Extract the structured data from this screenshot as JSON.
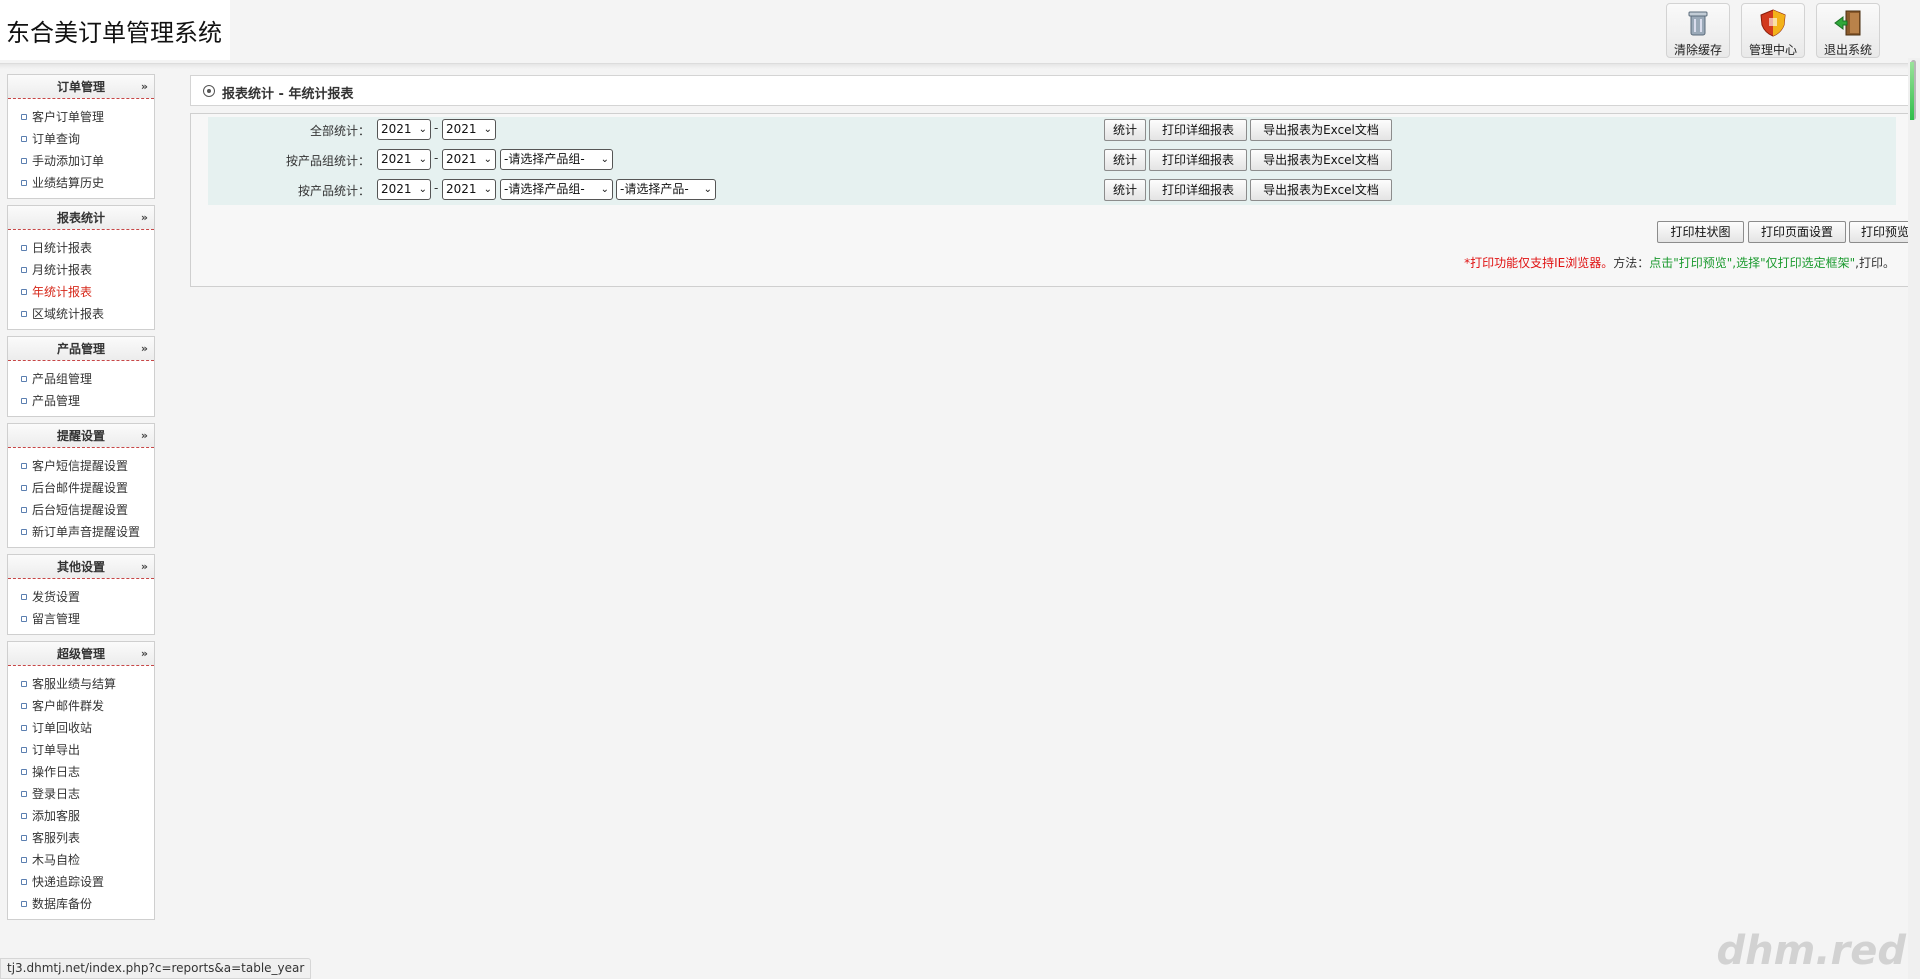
{
  "app": {
    "title": "东合美订单管理系统"
  },
  "toolbar": {
    "buttons": [
      {
        "label": "清除缓存",
        "icon": "trash-icon"
      },
      {
        "label": "管理中心",
        "icon": "shield-icon"
      },
      {
        "label": "退出系统",
        "icon": "exit-door-icon"
      }
    ]
  },
  "sidebar": {
    "groups": [
      {
        "title": "订单管理",
        "items": [
          "客户订单管理",
          "订单查询",
          "手动添加订单",
          "业绩结算历史"
        ]
      },
      {
        "title": "报表统计",
        "items": [
          "日统计报表",
          "月统计报表",
          "年统计报表",
          "区域统计报表"
        ],
        "active_index": 2
      },
      {
        "title": "产品管理",
        "items": [
          "产品组管理",
          "产品管理"
        ]
      },
      {
        "title": "提醒设置",
        "items": [
          "客户短信提醒设置",
          "后台邮件提醒设置",
          "后台短信提醒设置",
          "新订单声音提醒设置"
        ]
      },
      {
        "title": "其他设置",
        "items": [
          "发货设置",
          "留言管理"
        ]
      },
      {
        "title": "超级管理",
        "items": [
          "客服业绩与结算",
          "客户邮件群发",
          "订单回收站",
          "订单导出",
          "操作日志",
          "登录日志",
          "添加客服",
          "客服列表",
          "木马自检",
          "快递追踪设置",
          "数据库备份"
        ]
      }
    ]
  },
  "main": {
    "title": "报表统计 - 年统计报表",
    "rows": [
      {
        "label": "全部统计：",
        "year_from": "2021",
        "year_to": "2021",
        "group_select": null,
        "product_select": null
      },
      {
        "label": "按产品组统计：",
        "year_from": "2021",
        "year_to": "2021",
        "group_select": "-请选择产品组-",
        "product_select": null
      },
      {
        "label": "按产品统计：",
        "year_from": "2021",
        "year_to": "2021",
        "group_select": "-请选择产品组-",
        "product_select": "-请选择产品-"
      }
    ],
    "range_separator": "-",
    "row_buttons": {
      "stat": "统计",
      "print_detail": "打印详细报表",
      "export_excel": "导出报表为Excel文档"
    },
    "print_buttons": {
      "bar_chart": "打印柱状图",
      "page_setup": "打印页面设置",
      "preview": "打印预览"
    },
    "note": {
      "red": "*打印功能仅支持IE浏览器。",
      "dark1": "方法：",
      "green": "点击\"打印预览\",选择\"仅打印选定框架\"",
      "dark2": ",打印。"
    }
  },
  "status": {
    "url": "tj3.dhmtj.net/index.php?c=reports&a=table_year"
  },
  "watermark": {
    "text": "dhm.red"
  }
}
